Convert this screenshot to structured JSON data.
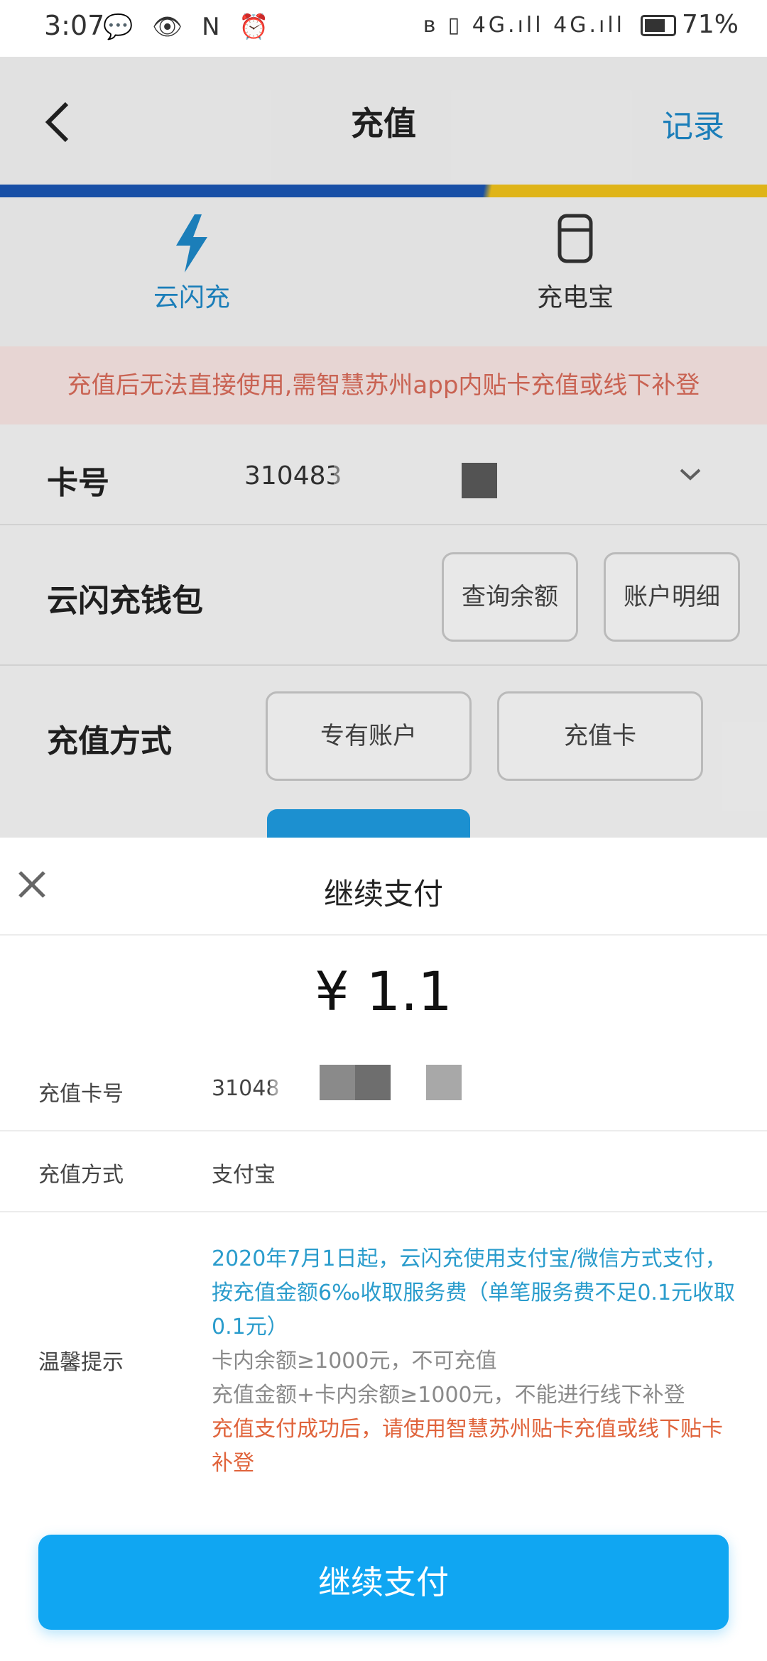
{
  "status_bar": {
    "time": "3:07",
    "left_icons": "💬 👁 N ⏰",
    "signal": "ʙ ▯ 4G.ıll 4G.ıll",
    "battery": "71%"
  },
  "header": {
    "title": "充值",
    "back_icon": "chevron-left-icon",
    "record_label": "记录"
  },
  "tabs": [
    {
      "label": "云闪充",
      "icon": "lightning-icon",
      "active": true,
      "color": "#1e88c8"
    },
    {
      "label": "充电宝",
      "icon": "power-bank-icon",
      "active": false,
      "color": "#333333"
    }
  ],
  "banner": {
    "text": "充值后无法直接使用,需智慧苏州app内贴卡充值或线下补登"
  },
  "card_row": {
    "label": "卡号",
    "value": "310483"
  },
  "wallet_row": {
    "label": "云闪充钱包",
    "balance_button": "查询余额",
    "detail_button": "账户明细"
  },
  "method_row": {
    "label": "充值方式",
    "option_1": "专有账户",
    "option_2": "充值卡"
  },
  "sheet": {
    "close_icon": "close-icon",
    "title": "继续支付",
    "amount": "¥ 1.1",
    "card_label": "充值卡号",
    "card_value": "31048",
    "method_label": "充值方式",
    "method_value": "支付宝",
    "tips_label": "温馨提示",
    "tip_blue": "2020年7月1日起，云闪充使用支付宝/微信方式支付，按充值金额6‰收取服务费（单笔服务费不足0.1元收取0.1元）",
    "tip_gray_1": "卡内余额≥1000元，不可充值",
    "tip_gray_2": "充值金额+卡内余额≥1000元，不能进行线下补登",
    "tip_orange": "充值支付成功后，请使用智慧苏州贴卡充值或线下贴卡补登",
    "pay_button": "继续支付"
  },
  "colors": {
    "accent": "#10a6f2",
    "link": "#1e88c8",
    "tip_blue": "#2a9ccc",
    "tip_orange": "#e0643c",
    "banner_text": "#d96b5a"
  }
}
